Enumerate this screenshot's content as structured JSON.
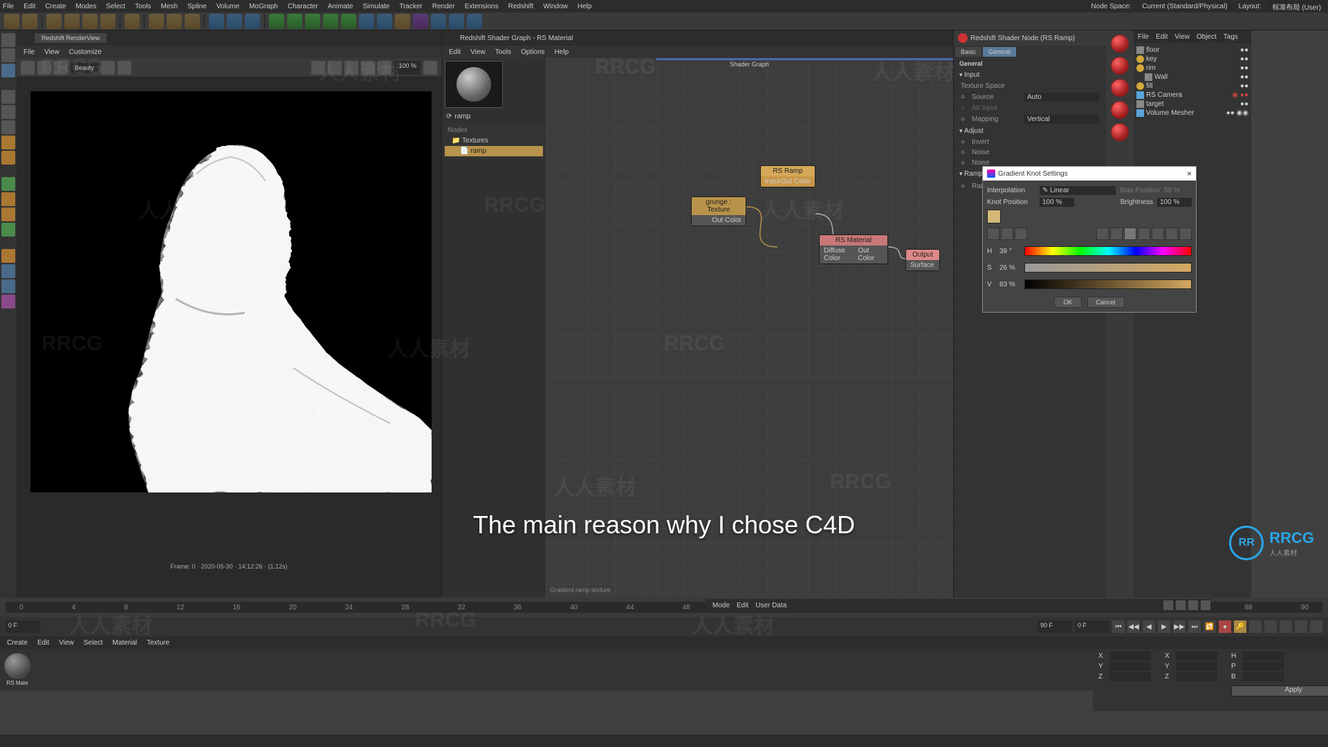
{
  "menubar": [
    "File",
    "Edit",
    "Create",
    "Modes",
    "Select",
    "Tools",
    "Mesh",
    "Spline",
    "Volume",
    "MoGraph",
    "Character",
    "Animate",
    "Simulate",
    "Tracker",
    "Render",
    "Extensions",
    "Redshift",
    "Window",
    "Help"
  ],
  "menubar_right": {
    "node_space": "Node Space:",
    "space_val": "Current (Standard/Physical)",
    "layout": "Layout:",
    "layout_val": "标准布局 (User)"
  },
  "render_panel": {
    "tab": "Redshift RenderView",
    "menus": [
      "File",
      "View",
      "Customize"
    ],
    "info": "Frame: 0 · 2020-05-30 · 14:12:26 · (1.12s)"
  },
  "shader_panel": {
    "tab": "Redshift Shader Graph - RS Material",
    "menus": [
      "Edit",
      "View",
      "Tools",
      "Options",
      "Help"
    ],
    "title": "Shader Graph",
    "info": "Gradient ramp texture",
    "ramp_label": "ramp",
    "nodes_section": {
      "hdr": "Nodes",
      "textures": "Textures",
      "ramp": "ramp"
    },
    "nodes": {
      "ramp": {
        "title": "RS Ramp",
        "in": "Input",
        "out": "Out Color"
      },
      "grunge": {
        "title": "grunge : Texture",
        "out": "Out Color"
      },
      "material": {
        "title": "RS Material",
        "in": "Diffuse Color",
        "out": "Out Color"
      },
      "output": {
        "title": "Output",
        "in": "Surface"
      }
    }
  },
  "attributes": {
    "title": "Redshift Shader Node (RS Ramp)",
    "tabs": [
      "Basic",
      "General"
    ],
    "sections": {
      "general": "General",
      "input": "Input",
      "texture_space": "Texture Space",
      "source": "Source",
      "source_val": "Auto",
      "alt_input": "Alt Input",
      "mapping": "Mapping",
      "mapping_val": "Vertical",
      "adjust": "Adjust",
      "invert": "Invert",
      "noise": "Noise",
      "noise_f": "Noise",
      "ramp": "Ramp",
      "ramp2": "Ramp"
    }
  },
  "scene": {
    "menus": [
      "File",
      "Edit",
      "View",
      "Object",
      "Tags"
    ],
    "items": [
      "floor",
      "key",
      "rim",
      "Wall",
      "fill",
      "RS Camera",
      "target",
      "Volume Mesher"
    ]
  },
  "dialog": {
    "title": "Gradient Knot Settings",
    "interp": "Interpolation",
    "interp_val": "Linear",
    "bias": "Bias Position",
    "bias_val": "50 %",
    "pos": "Knot Position",
    "pos_val": "100 %",
    "bright": "Brightness",
    "bright_val": "100 %",
    "h": "H",
    "h_val": "39 °",
    "s": "S",
    "s_val": "26 %",
    "v": "V",
    "v_val": "83 %",
    "ok": "OK",
    "cancel": "Cancel"
  },
  "timeline": {
    "start": "0 F",
    "end": "90 F",
    "cur": "0 F"
  },
  "material_bar": [
    "Create",
    "Edit",
    "View",
    "Select",
    "Material",
    "Texture"
  ],
  "mat_label": "RS Mate",
  "coords": {
    "apply": "Apply"
  },
  "attr_tab_bar": [
    "Mode",
    "Edit",
    "User Data"
  ],
  "subtitle": "The main reason why I chose C4D",
  "logo": {
    "abbr": "RR",
    "text": "RRCG",
    "sub": "人人素材"
  }
}
